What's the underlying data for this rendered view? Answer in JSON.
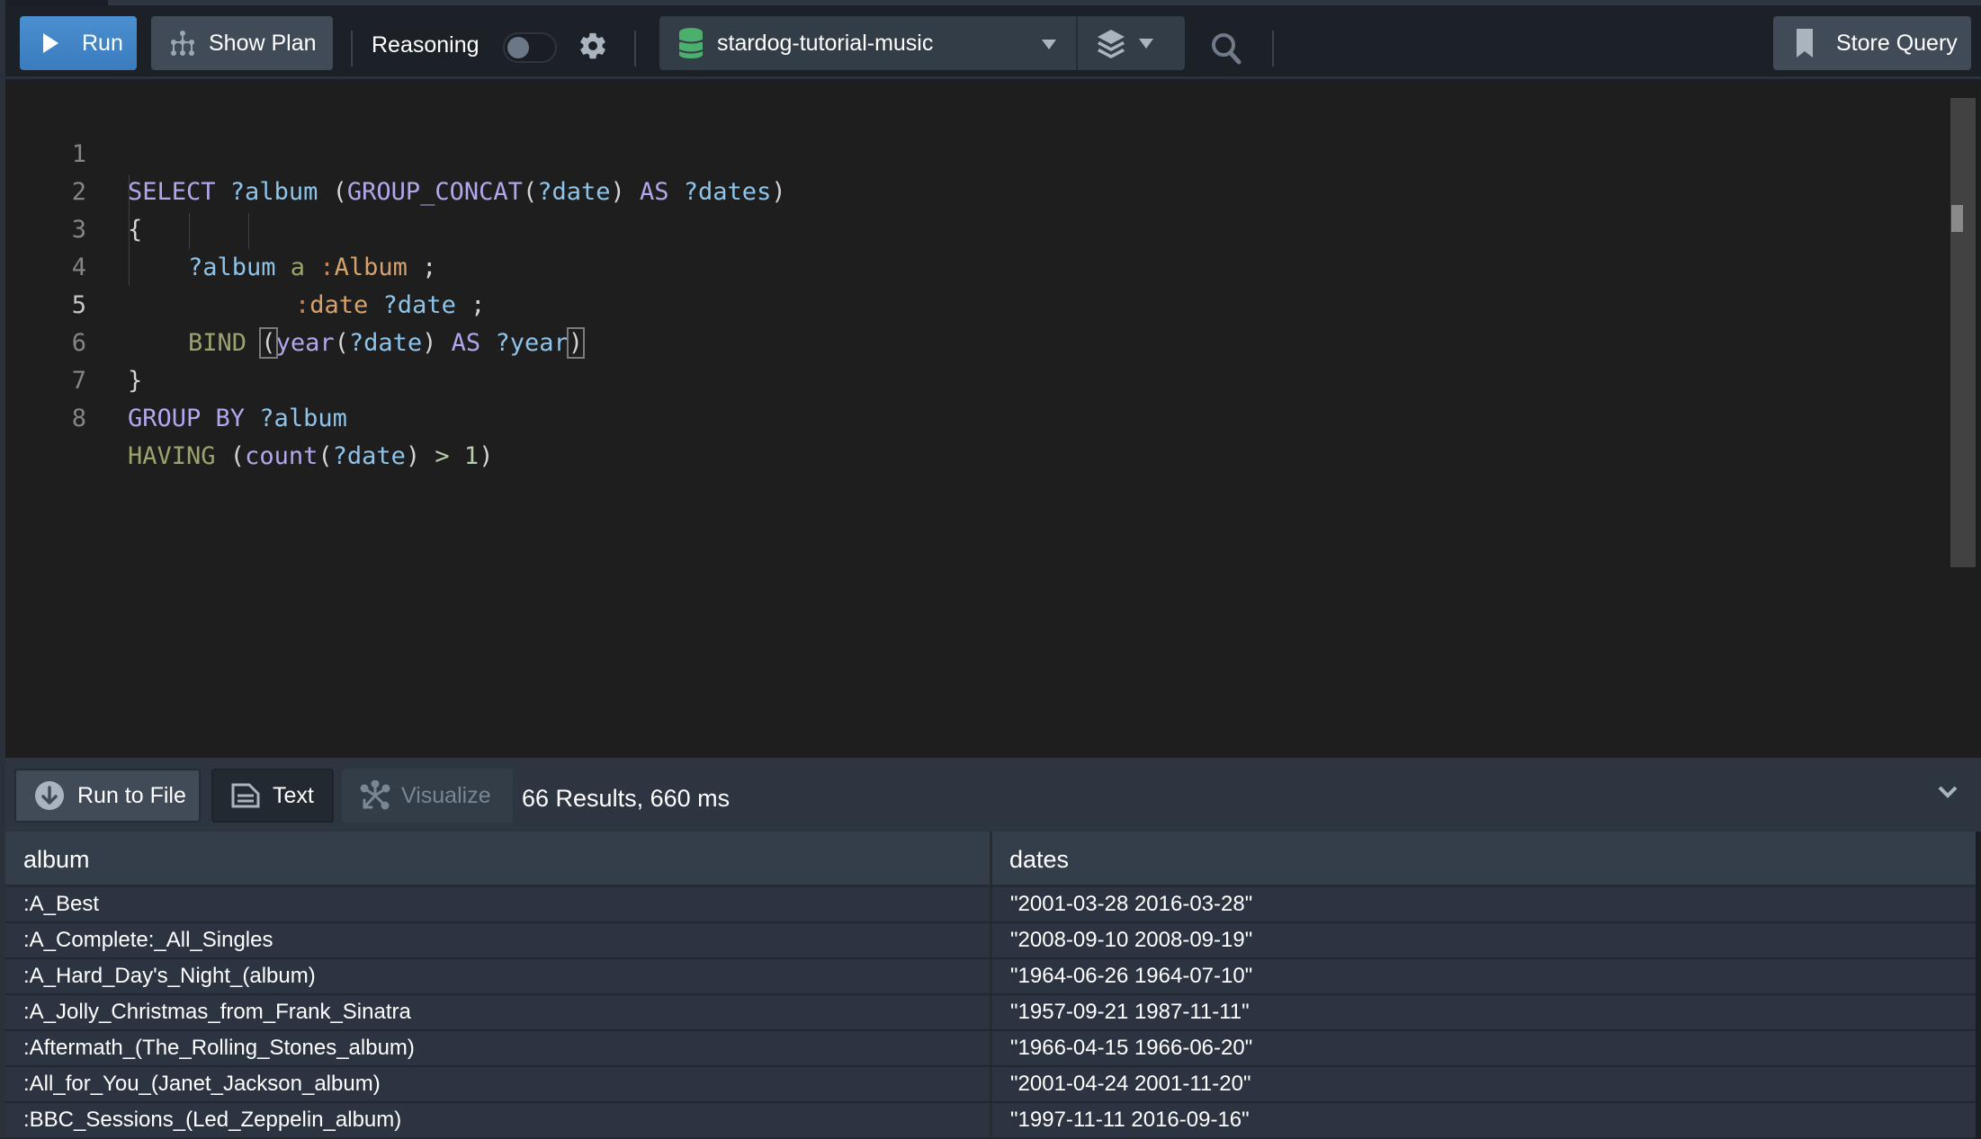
{
  "toolbar": {
    "run_label": "Run",
    "show_plan_label": "Show Plan",
    "reasoning_label": "Reasoning",
    "reasoning_enabled": false,
    "database": "stardog-tutorial-music",
    "store_query_label": "Store Query"
  },
  "editor": {
    "active_line": 5,
    "lines": [
      {
        "n": "1"
      },
      {
        "n": "2"
      },
      {
        "n": "3"
      },
      {
        "n": "4"
      },
      {
        "n": "5"
      },
      {
        "n": "6"
      },
      {
        "n": "7"
      },
      {
        "n": "8"
      }
    ],
    "tokens": {
      "l1": [
        "SELECT",
        " ?album",
        " (",
        "GROUP_CONCAT",
        "(",
        "?date",
        ")",
        " AS",
        " ?dates",
        ")"
      ],
      "l2": [
        "{"
      ],
      "l3": [
        "?album",
        " a",
        " :",
        "Album",
        " ;"
      ],
      "l4": [
        ":",
        "date",
        " ?date",
        " ;"
      ],
      "l5": [
        "BIND",
        " ",
        "(",
        "year",
        "(",
        "?date",
        ")",
        " AS",
        " ?year",
        ")"
      ],
      "l6": [
        "}"
      ],
      "l7": [
        "GROUP BY",
        " ?album"
      ],
      "l8": [
        "HAVING",
        " (",
        "count",
        "(",
        "?date",
        ")",
        " >",
        " 1",
        ")"
      ]
    }
  },
  "results": {
    "run_to_file_label": "Run to File",
    "text_label": "Text",
    "visualize_label": "Visualize",
    "count_text": "66 Results,  660 ms",
    "columns": [
      "album",
      "dates"
    ],
    "rows": [
      [
        ":A_Best",
        "\"2001-03-28 2016-03-28\""
      ],
      [
        ":A_Complete:_All_Singles",
        "\"2008-09-10 2008-09-19\""
      ],
      [
        ":A_Hard_Day's_Night_(album)",
        "\"1964-06-26 1964-07-10\""
      ],
      [
        ":A_Jolly_Christmas_from_Frank_Sinatra",
        "\"1957-09-21 1987-11-11\""
      ],
      [
        ":Aftermath_(The_Rolling_Stones_album)",
        "\"1966-04-15 1966-06-20\""
      ],
      [
        ":All_for_You_(Janet_Jackson_album)",
        "\"2001-04-24 2001-11-20\""
      ],
      [
        ":BBC_Sessions_(Led_Zeppelin_album)",
        "\"1997-11-11 2016-09-16\""
      ]
    ]
  },
  "colors": {
    "run_button": "#3a7cbf",
    "database_icon": "#4caf6e",
    "editor_bg": "#1e1e1e",
    "keyword": "#b4a6ec",
    "variable": "#8fc4ea"
  }
}
